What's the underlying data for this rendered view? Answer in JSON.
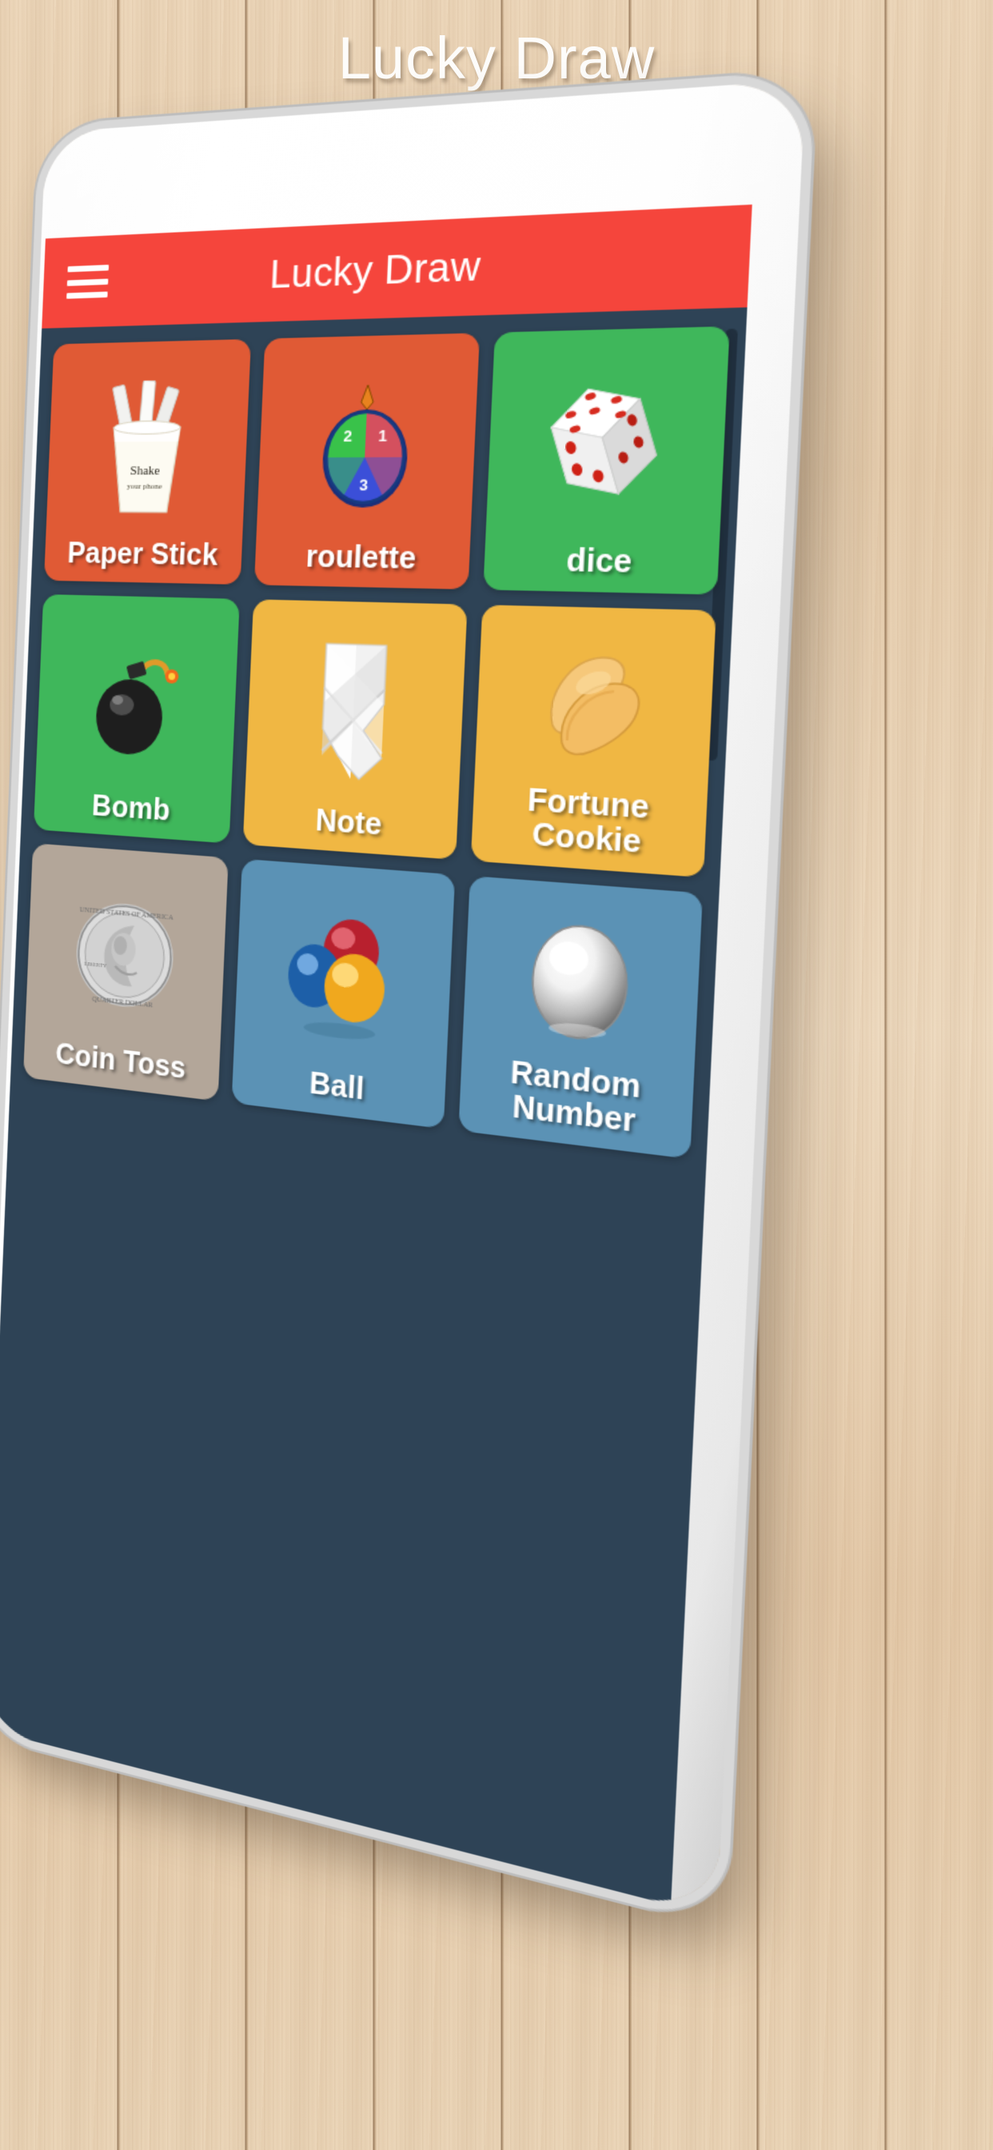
{
  "headline": {
    "title_main": "Lucky Draw",
    "title_sub": "Lucky Draw"
  },
  "app": {
    "appbar": {
      "title": "Lucky Draw",
      "menu_icon": "hamburger-menu-icon",
      "background_color": "#F5453C",
      "text_color": "#FFFFFF"
    },
    "content": {
      "background_color": "#2E4356",
      "scrollbar_color": "#1D2C3A"
    },
    "grid": {
      "columns": 3,
      "tiles": [
        {
          "label": "Paper Stick",
          "color": "#E05A35",
          "icon": "paper-cup-sticks-icon",
          "cup_text_line1": "Shake",
          "cup_text_line2": "your phone"
        },
        {
          "label": "roulette",
          "color": "#E05A35",
          "icon": "roulette-wheel-icon",
          "segments": [
            "1",
            "2",
            "3"
          ]
        },
        {
          "label": "dice",
          "color": "#3FB75B",
          "icon": "dice-icon"
        },
        {
          "label": "Bomb",
          "color": "#3FB75B",
          "icon": "bomb-icon"
        },
        {
          "label": "Note",
          "color": "#F0B743",
          "icon": "folded-note-icon"
        },
        {
          "label": "Fortune\nCookie",
          "color": "#F0B743",
          "icon": "fortune-cookie-icon"
        },
        {
          "label": "Coin Toss",
          "color": "#B3A699",
          "icon": "quarter-coin-icon"
        },
        {
          "label": "Ball",
          "color": "#5B92B5",
          "icon": "three-balls-icon"
        },
        {
          "label": "Random\nNumber",
          "color": "#5B92B5",
          "icon": "silver-ball-icon"
        }
      ]
    }
  }
}
